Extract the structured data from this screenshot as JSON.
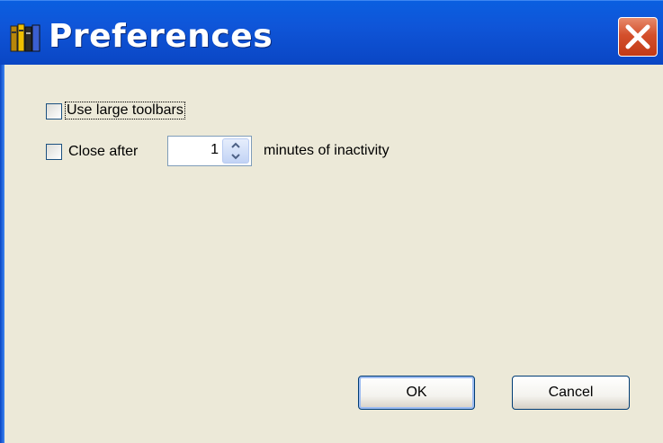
{
  "window": {
    "title": "Preferences",
    "close_icon": "close-icon",
    "app_icon": "books-icon"
  },
  "options": {
    "large_toolbars": {
      "label": "Use large toolbars",
      "checked": false
    },
    "close_after": {
      "label": "Close after",
      "checked": false,
      "value": "1",
      "suffix": "minutes of inactivity"
    }
  },
  "buttons": {
    "ok": "OK",
    "cancel": "Cancel"
  },
  "colors": {
    "titlebar": "#0a5fe0",
    "close": "#d4502c",
    "background": "#ece9d8"
  }
}
